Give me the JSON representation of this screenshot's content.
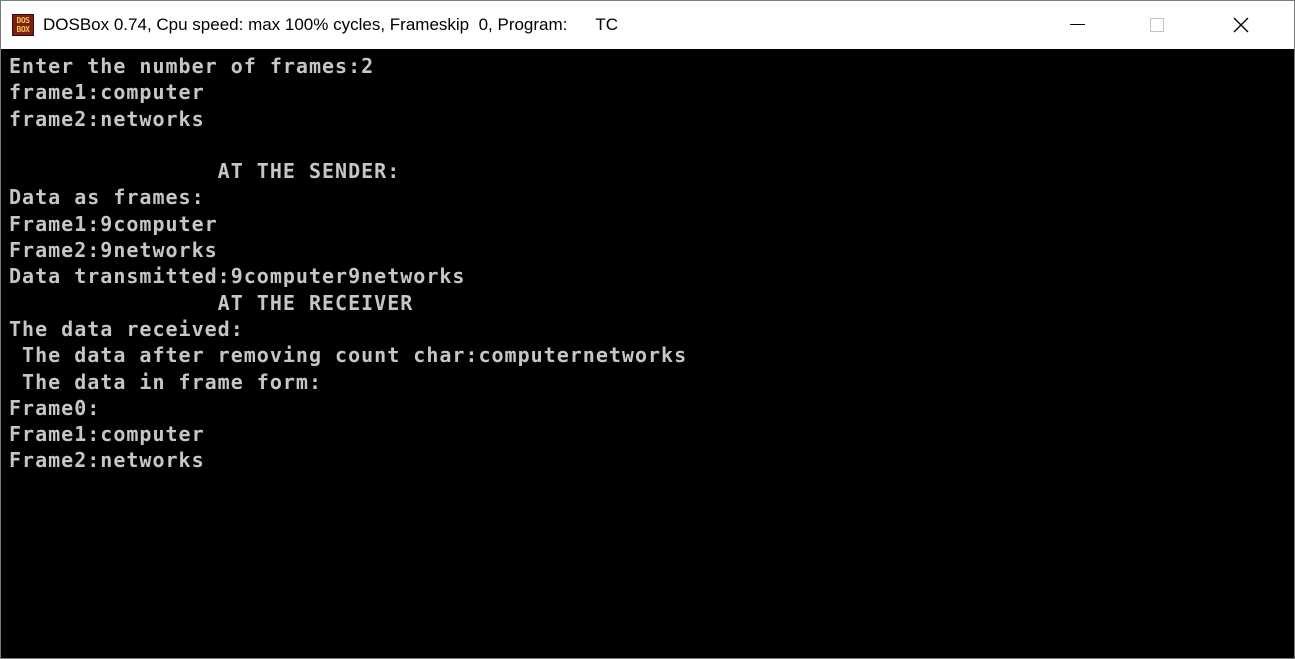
{
  "window": {
    "title": "DOSBox 0.74, Cpu speed: max 100% cycles, Frameskip  0, Program:      TC",
    "icon": {
      "name": "dosbox-icon",
      "text_top": "DOS",
      "text_bottom": "BOX"
    },
    "controls": {
      "minimize": "minimize-icon",
      "maximize": "maximize-icon",
      "close": "close-icon"
    }
  },
  "console": {
    "foreground": "#c6c6c6",
    "background": "#000000",
    "lines": [
      "Enter the number of frames:2",
      "frame1:computer",
      "frame2:networks",
      "",
      "                AT THE SENDER:",
      "Data as frames:",
      "Frame1:9computer",
      "Frame2:9networks",
      "Data transmitted:9computer9networks",
      "                AT THE RECEIVER",
      "The data received:",
      " The data after removing count char:computernetworks",
      " The data in frame form:",
      "Frame0:",
      "Frame1:computer",
      "Frame2:networks"
    ]
  }
}
